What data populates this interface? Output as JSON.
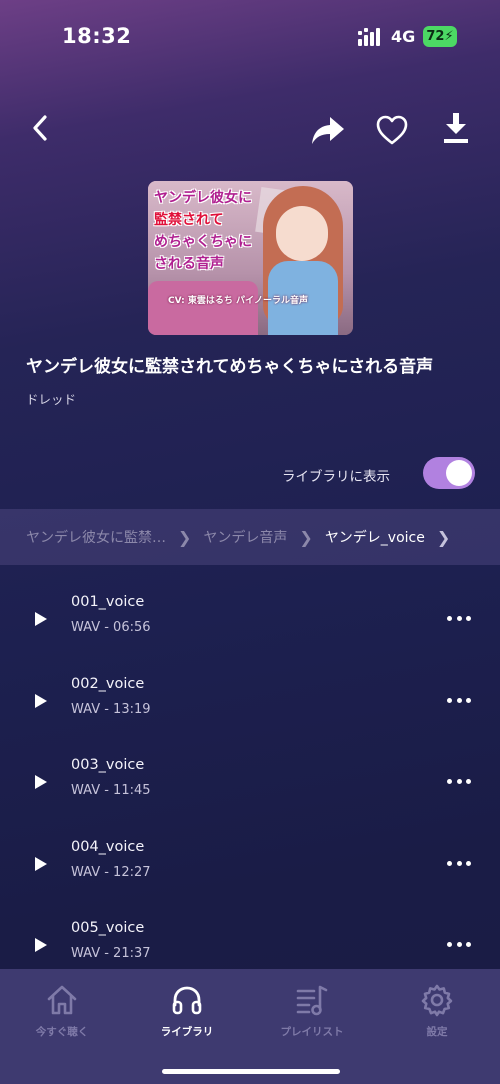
{
  "status": {
    "time": "18:32",
    "network": "4G",
    "battery": "72"
  },
  "icons": {
    "back": "chevron-left-icon",
    "share": "share-icon",
    "heart": "heart-icon",
    "download": "download-icon"
  },
  "album": {
    "title": "ヤンデレ彼女に監禁されてめちゃくちゃにされる音声",
    "artist": "ドレッド",
    "cover_text": [
      "ヤンデレ彼女に",
      "監禁されて",
      "めちゃくちゃに",
      "される音声"
    ],
    "cover_cv": "CV: 東雲はるち パイノーラル音声"
  },
  "library_toggle": {
    "label": "ライブラリに表示",
    "on": true
  },
  "breadcrumb": [
    {
      "label": "ヤンデレ彼女に監禁…"
    },
    {
      "label": "ヤンデレ音声"
    },
    {
      "label": "ヤンデレ_voice"
    }
  ],
  "tracks": [
    {
      "name": "001_voice",
      "meta": "WAV - 06:56"
    },
    {
      "name": "002_voice",
      "meta": "WAV - 13:19"
    },
    {
      "name": "003_voice",
      "meta": "WAV - 11:45"
    },
    {
      "name": "004_voice",
      "meta": "WAV - 12:27"
    },
    {
      "name": "005_voice",
      "meta": "WAV - 21:37"
    }
  ],
  "tabs": [
    {
      "label": "今すぐ聴く",
      "icon": "home-icon",
      "active": false
    },
    {
      "label": "ライブラリ",
      "icon": "headphones-icon",
      "active": true
    },
    {
      "label": "プレイリスト",
      "icon": "playlist-icon",
      "active": false
    },
    {
      "label": "設定",
      "icon": "gear-icon",
      "active": false
    }
  ],
  "colors": {
    "accent": "#b181e0",
    "tab_active": "#ffffff",
    "tab_inactive": "#7f7aa8"
  }
}
